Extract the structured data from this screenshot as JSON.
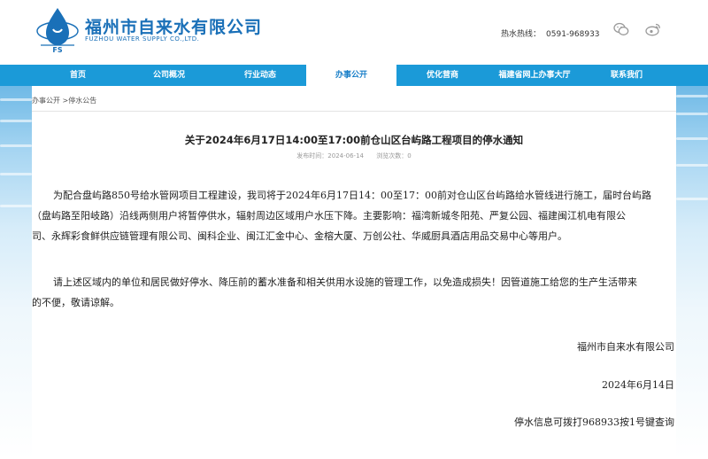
{
  "header": {
    "company_cn": "福州市自来水有限公司",
    "company_en": "FUZHOU WATER SUPPLY CO.,LTD.",
    "logo_letters": "FS",
    "hotline_label": "热水热线：",
    "hotline_number": "0591-968933",
    "brand_color": "#1a70b8"
  },
  "nav": {
    "items": [
      {
        "label": "首页"
      },
      {
        "label": "公司概况"
      },
      {
        "label": "行业动态"
      },
      {
        "label": "办事公开"
      },
      {
        "label": "优化营商"
      },
      {
        "label": "福建省网上办事大厅"
      },
      {
        "label": "联系我们"
      }
    ],
    "active_index": 3,
    "bar_color": "#1b9ad8"
  },
  "breadcrumb": "办事公开 >停水公告",
  "article": {
    "title": "关于2024年6月17日14:00至17:00前仓山区台屿路工程项目的停水通知",
    "publish_label": "发布时间：2024-06-14",
    "views_label": "浏览次数：0",
    "p1_lines": [
      "为配合盘屿路850号给水管网项目工程建设，我司将于2024年6月17日14：00至17：00前对仓山区台屿路给水管线进行施工，届时台屿路",
      "（盘屿路至阳岐路）沿线两侧用户将暂停供水，辐射周边区域用户水压下降。主要影响：福湾新城冬阳苑、严复公园、福建闽江机电有限公",
      "司、永辉彩食鲜供应链管理有限公司、闽科企业、闽江汇金中心、金榕大厦、万创公社、华威厨具酒店用品交易中心等用户。"
    ],
    "p2_lines": [
      "请上述区域内的单位和居民做好停水、降压前的蓄水准备和相关供用水设施的管理工作，以免造成损失！因管道施工给您的生产生活带来",
      "的不便，敬请谅解。"
    ],
    "signature": "福州市自来水有限公司",
    "date": "2024年6月14日",
    "inquiry": "停水信息可拨打968933按1号键查询"
  }
}
